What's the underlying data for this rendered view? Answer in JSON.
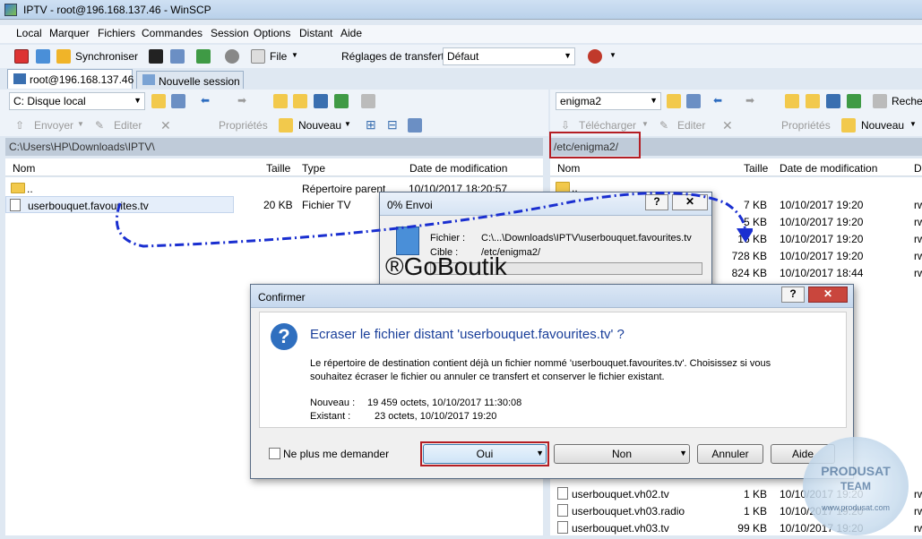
{
  "window": {
    "title": "IPTV - root@196.168.137.46 - WinSCP"
  },
  "menu": [
    "Local",
    "Marquer",
    "Fichiers",
    "Commandes",
    "Session",
    "Options",
    "Distant",
    "Aide"
  ],
  "toolbar": {
    "sync_label": "Synchroniser",
    "file_label": "File",
    "transfer_settings_label": "Réglages de transfert",
    "transfer_preset": "Défaut"
  },
  "tabs": {
    "session": "root@196.168.137.46",
    "new_session": "Nouvelle session"
  },
  "left": {
    "drive": "C: Disque local",
    "actions": {
      "send": "Envoyer",
      "edit": "Editer",
      "properties": "Propriétés",
      "new": "Nouveau"
    },
    "path": "C:\\Users\\HP\\Downloads\\IPTV\\",
    "columns": [
      "Nom",
      "Taille",
      "Type",
      "Date de modification"
    ],
    "rows": [
      {
        "name": "..",
        "size": "",
        "type": "Répertoire parent",
        "date": "10/10/2017  18:20:57"
      },
      {
        "name": "userbouquet.favourites.tv",
        "size": "20 KB",
        "type": "Fichier TV",
        "date": ""
      }
    ]
  },
  "right": {
    "drive": "enigma2",
    "search_label": "Reche",
    "actions": {
      "download": "Télécharger",
      "edit": "Editer",
      "properties": "Propriétés",
      "new": "Nouveau"
    },
    "path": "/etc/enigma2/",
    "columns": [
      "Nom",
      "Taille",
      "Date de modification",
      "D"
    ],
    "rows": [
      {
        "name": "..",
        "size": "",
        "date": "",
        "r": ""
      },
      {
        "name": "",
        "size": "7 KB",
        "date": "10/10/2017 19:20",
        "r": "rw"
      },
      {
        "name": "",
        "size": "5 KB",
        "date": "10/10/2017 19:20",
        "r": "rw"
      },
      {
        "name": "",
        "size": "16 KB",
        "date": "10/10/2017 19:20",
        "r": "rw"
      },
      {
        "name": "",
        "size": "728 KB",
        "date": "10/10/2017 19:20",
        "r": "rw"
      },
      {
        "name": "",
        "size": "824 KB",
        "date": "10/10/2017 18:44",
        "r": "rw"
      }
    ],
    "bottom_rows": [
      {
        "name": "userbouquet.vh02.tv",
        "size": "1 KB",
        "date": "10/10/2017 19:20",
        "r": "rw"
      },
      {
        "name": "userbouquet.vh03.radio",
        "size": "1 KB",
        "date": "10/10/2017 19:20",
        "r": "rw"
      },
      {
        "name": "userbouquet.vh03.tv",
        "size": "99 KB",
        "date": "10/10/2017 19:20",
        "r": "rw"
      }
    ]
  },
  "progress": {
    "title": "0% Envoi",
    "file_label": "Fichier :",
    "file_value": "C:\\...\\Downloads\\IPTV\\userbouquet.favourites.tv",
    "target_label": "Cible :",
    "target_value": "/etc/enigma2/",
    "percent": 0
  },
  "watermark": "®GoBoutik",
  "confirm": {
    "title": "Confirmer",
    "heading": "Ecraser le fichier distant 'userbouquet.favourites.tv' ?",
    "message": "Le répertoire de destination contient déjà un fichier nommé 'userbouquet.favourites.tv'. Choisissez si vous souhaitez écraser le fichier ou annuler ce transfert et conserver le fichier existant.",
    "new_label": "Nouveau :",
    "new_value": "19 459 octets, 10/10/2017 11:30:08",
    "existing_label": "Existant :",
    "existing_value": "23 octets, 10/10/2017 19:20",
    "checkbox": "Ne plus me demander",
    "yes": "Oui",
    "no": "Non",
    "cancel": "Annuler",
    "help": "Aide"
  },
  "stamp": {
    "top": "PRODUSAT",
    "mid": "TEAM",
    "url": "www.produsat.com"
  },
  "colors": {
    "accent_red": "#b41e24",
    "arrow_blue": "#1a2fd0"
  }
}
